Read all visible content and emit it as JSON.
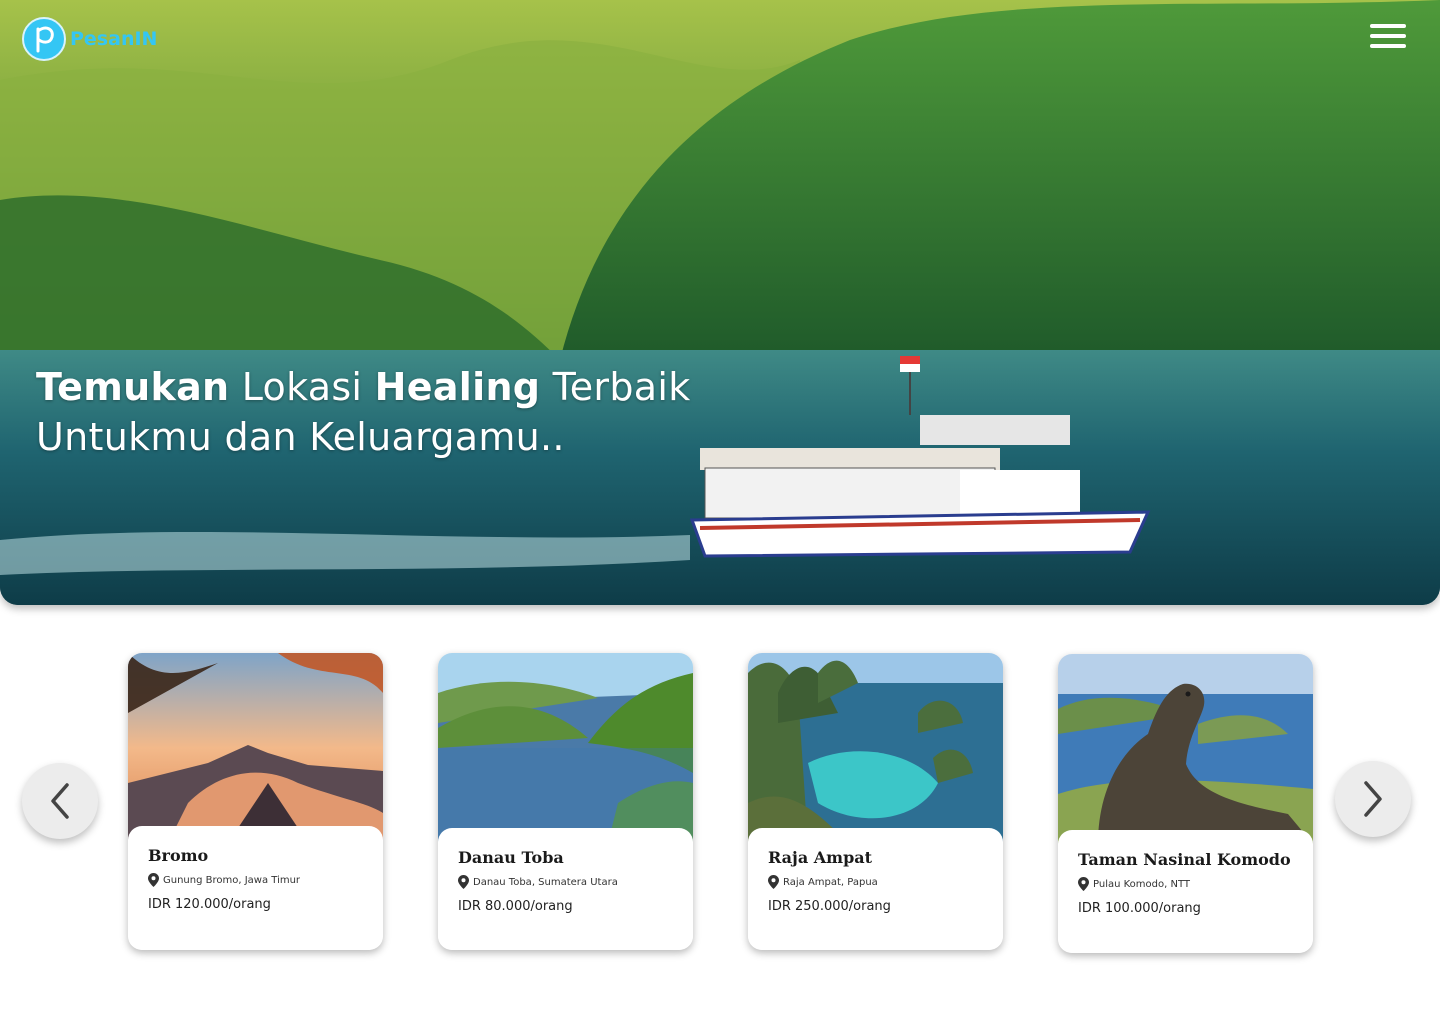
{
  "brand": {
    "name": "PesanIN",
    "accent": "#34c6f4"
  },
  "header": {
    "menu_icon": "hamburger-menu-icon"
  },
  "hero": {
    "headline_bold_1": "Temukan",
    "headline_regular_1": " Lokasi ",
    "headline_bold_2": "Healing",
    "headline_regular_2": " Terbaik",
    "headline_line_2": "Untukmu dan Keluargamu.."
  },
  "carousel": {
    "prev_icon": "chevron-left-icon",
    "next_icon": "chevron-right-icon",
    "destinations": [
      {
        "name": "Bromo",
        "location": "Gunung Bromo, Jawa Timur",
        "price": "IDR 120.000/orang"
      },
      {
        "name": "Danau Toba",
        "location": "Danau Toba, Sumatera Utara",
        "price": "IDR 80.000/orang"
      },
      {
        "name": "Raja Ampat",
        "location": "Raja Ampat, Papua",
        "price": "IDR 250.000/orang"
      },
      {
        "name": "Taman Nasinal Komodo",
        "location": "Pulau Komodo, NTT",
        "price": "IDR 100.000/orang"
      }
    ]
  }
}
